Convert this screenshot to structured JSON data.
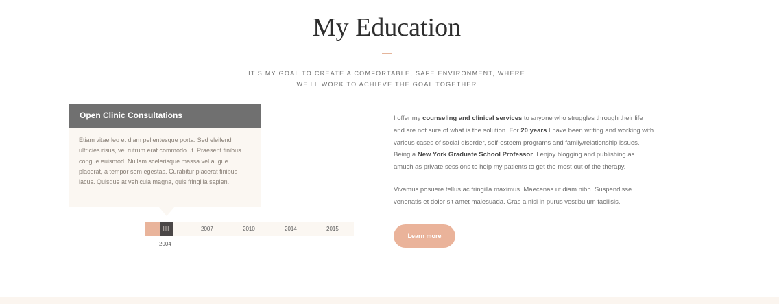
{
  "section": {
    "title": "My Education",
    "subtitle_line1": "IT'S MY GOAL TO CREATE A COMFORTABLE, SAFE ENVIRONMENT, WHERE",
    "subtitle_line2": "WE'LL WORK TO ACHIEVE THE GOAL TOGETHER",
    "accent_color": "#e5b59b"
  },
  "card": {
    "title": "Open Clinic Consultations",
    "body": "Etiam vitae leo et diam pellentesque porta. Sed eleifend ultricies risus, vel rutrum erat commodo ut. Praesent finibus congue euismod. Nullam scelerisque massa vel augue placerat, a tempor sem egestas. Curabitur placerat finibus lacus. Quisque at vehicula magna, quis fringilla sapien."
  },
  "timeline": {
    "handle_glyph": "III",
    "selected_year": "2004",
    "years": [
      "2007",
      "2010",
      "2014",
      "2015"
    ],
    "progress_fraction": 0.08,
    "fill_color": "#e9b49b",
    "handle_color": "#4b4747"
  },
  "intro": {
    "p1_a": "I offer my ",
    "p1_b": "counseling and clinical services",
    "p1_c": " to anyone who struggles through their life and are not sure of what is the solution. For ",
    "p1_d": "20 years",
    "p1_e": " I have been writing and working with various cases of social disorder, self-esteem programs and family/relationship issues. Being a ",
    "p1_f": "New York Graduate School Professor",
    "p1_g": ", I enjoy blogging and publishing as amuch as private sessions to help my patients to get the most out of the therapy.",
    "p2": "Vivamus posuere tellus ac fringilla maximus. Maecenas ut diam nibh. Suspendisse venenatis et dolor sit amet malesuada. Cras a nisl in purus vestibulum facilisis.",
    "button_label": "Learn more",
    "button_color": "#eab39a"
  }
}
